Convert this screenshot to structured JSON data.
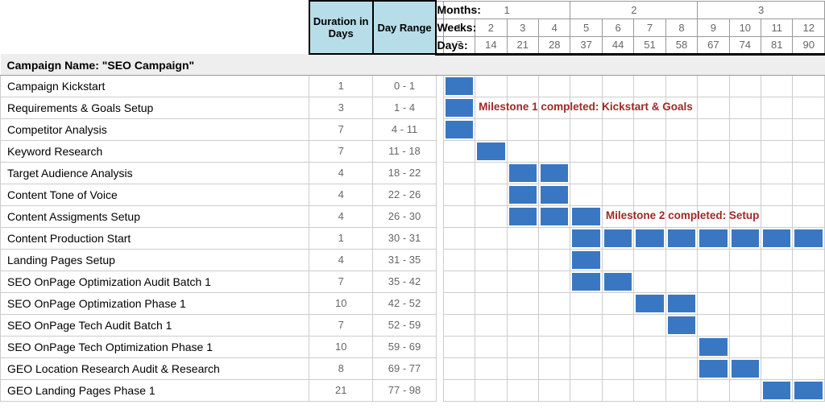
{
  "header": {
    "duration_label": "Duration in Days",
    "range_label": "Day Range",
    "months_label": "Months:",
    "weeks_label": "Weeks:",
    "days_label": "Days:",
    "months": [
      {
        "label": "1",
        "span": 4
      },
      {
        "label": "2",
        "span": 4
      },
      {
        "label": "3",
        "span": 4
      }
    ],
    "weeks": [
      "1",
      "2",
      "3",
      "4",
      "5",
      "6",
      "7",
      "8",
      "9",
      "10",
      "11",
      "12"
    ],
    "days": [
      "7",
      "14",
      "21",
      "28",
      "37",
      "44",
      "51",
      "58",
      "67",
      "74",
      "81",
      "90"
    ]
  },
  "campaign_title": "Campaign Name: \"SEO Campaign\"",
  "tasks": [
    {
      "name": "Campaign Kickstart",
      "dur": "1",
      "range": "0 - 1",
      "bars": [
        0
      ]
    },
    {
      "name": "Requirements & Goals Setup",
      "dur": "3",
      "range": "1 - 4",
      "bars": [
        0
      ],
      "milestone": {
        "col": 1,
        "text": "Milestone 1 completed: Kickstart & Goals"
      }
    },
    {
      "name": "Competitor Analysis",
      "dur": "7",
      "range": "4 - 11",
      "bars": [
        0
      ]
    },
    {
      "name": "Keyword Research",
      "dur": "7",
      "range": "11 - 18",
      "bars": [
        1
      ]
    },
    {
      "name": "Target Audience Analysis",
      "dur": "4",
      "range": "18 - 22",
      "bars": [
        2,
        3
      ]
    },
    {
      "name": "Content Tone of Voice",
      "dur": "4",
      "range": "22 - 26",
      "bars": [
        2,
        3
      ]
    },
    {
      "name": "Content Assigments Setup",
      "dur": "4",
      "range": "26 - 30",
      "bars": [
        2,
        3,
        4
      ],
      "milestone": {
        "col": 5,
        "text": "Milestone 2 completed: Setup"
      }
    },
    {
      "name": "Content Production Start",
      "dur": "1",
      "range": "30 - 31",
      "bars": [
        4,
        5,
        6,
        7,
        8,
        9,
        10,
        11
      ]
    },
    {
      "name": "Landing Pages Setup",
      "dur": "4",
      "range": "31 - 35",
      "bars": [
        4
      ]
    },
    {
      "name": "SEO OnPage Optimization Audit Batch 1",
      "dur": "7",
      "range": "35 - 42",
      "bars": [
        4,
        5
      ]
    },
    {
      "name": "SEO OnPage Optimization Phase 1",
      "dur": "10",
      "range": "42 - 52",
      "bars": [
        6,
        7
      ]
    },
    {
      "name": "SEO OnPage Tech Audit Batch 1",
      "dur": "7",
      "range": "52 - 59",
      "bars": [
        7
      ]
    },
    {
      "name": "SEO OnPage Tech Optimization Phase 1",
      "dur": "10",
      "range": "59 - 69",
      "bars": [
        8
      ]
    },
    {
      "name": "GEO Location Research Audit & Research",
      "dur": "8",
      "range": "69 - 77",
      "bars": [
        8,
        9
      ]
    },
    {
      "name": "GEO Landing Pages Phase 1",
      "dur": "21",
      "range": "77 - 98",
      "bars": [
        10,
        11
      ]
    }
  ],
  "chart_data": {
    "type": "bar",
    "title": "Campaign Name: \"SEO Campaign\"",
    "xlabel": "Days",
    "ylabel": "",
    "x_ticks": [
      7,
      14,
      21,
      28,
      37,
      44,
      51,
      58,
      67,
      74,
      81,
      90
    ],
    "weeks": [
      1,
      2,
      3,
      4,
      5,
      6,
      7,
      8,
      9,
      10,
      11,
      12
    ],
    "months": [
      1,
      1,
      1,
      1,
      2,
      2,
      2,
      2,
      3,
      3,
      3,
      3
    ],
    "series": [
      {
        "name": "Campaign Kickstart",
        "start": 0,
        "end": 1,
        "duration": 1
      },
      {
        "name": "Requirements & Goals Setup",
        "start": 1,
        "end": 4,
        "duration": 3
      },
      {
        "name": "Competitor Analysis",
        "start": 4,
        "end": 11,
        "duration": 7
      },
      {
        "name": "Keyword Research",
        "start": 11,
        "end": 18,
        "duration": 7
      },
      {
        "name": "Target Audience Analysis",
        "start": 18,
        "end": 22,
        "duration": 4
      },
      {
        "name": "Content Tone of Voice",
        "start": 22,
        "end": 26,
        "duration": 4
      },
      {
        "name": "Content Assigments Setup",
        "start": 26,
        "end": 30,
        "duration": 4
      },
      {
        "name": "Content Production Start",
        "start": 30,
        "end": 31,
        "duration": 1
      },
      {
        "name": "Landing Pages Setup",
        "start": 31,
        "end": 35,
        "duration": 4
      },
      {
        "name": "SEO OnPage Optimization Audit Batch 1",
        "start": 35,
        "end": 42,
        "duration": 7
      },
      {
        "name": "SEO OnPage Optimization Phase 1",
        "start": 42,
        "end": 52,
        "duration": 10
      },
      {
        "name": "SEO OnPage Tech Audit Batch 1",
        "start": 52,
        "end": 59,
        "duration": 7
      },
      {
        "name": "SEO OnPage Tech Optimization Phase 1",
        "start": 59,
        "end": 69,
        "duration": 10
      },
      {
        "name": "GEO Location Research Audit & Research",
        "start": 69,
        "end": 77,
        "duration": 8
      },
      {
        "name": "GEO Landing Pages Phase 1",
        "start": 77,
        "end": 98,
        "duration": 21
      }
    ],
    "milestones": [
      {
        "after_task": "Requirements & Goals Setup",
        "text": "Milestone 1 completed: Kickstart & Goals"
      },
      {
        "after_task": "Content Assigments Setup",
        "text": "Milestone 2 completed: Setup"
      }
    ]
  }
}
